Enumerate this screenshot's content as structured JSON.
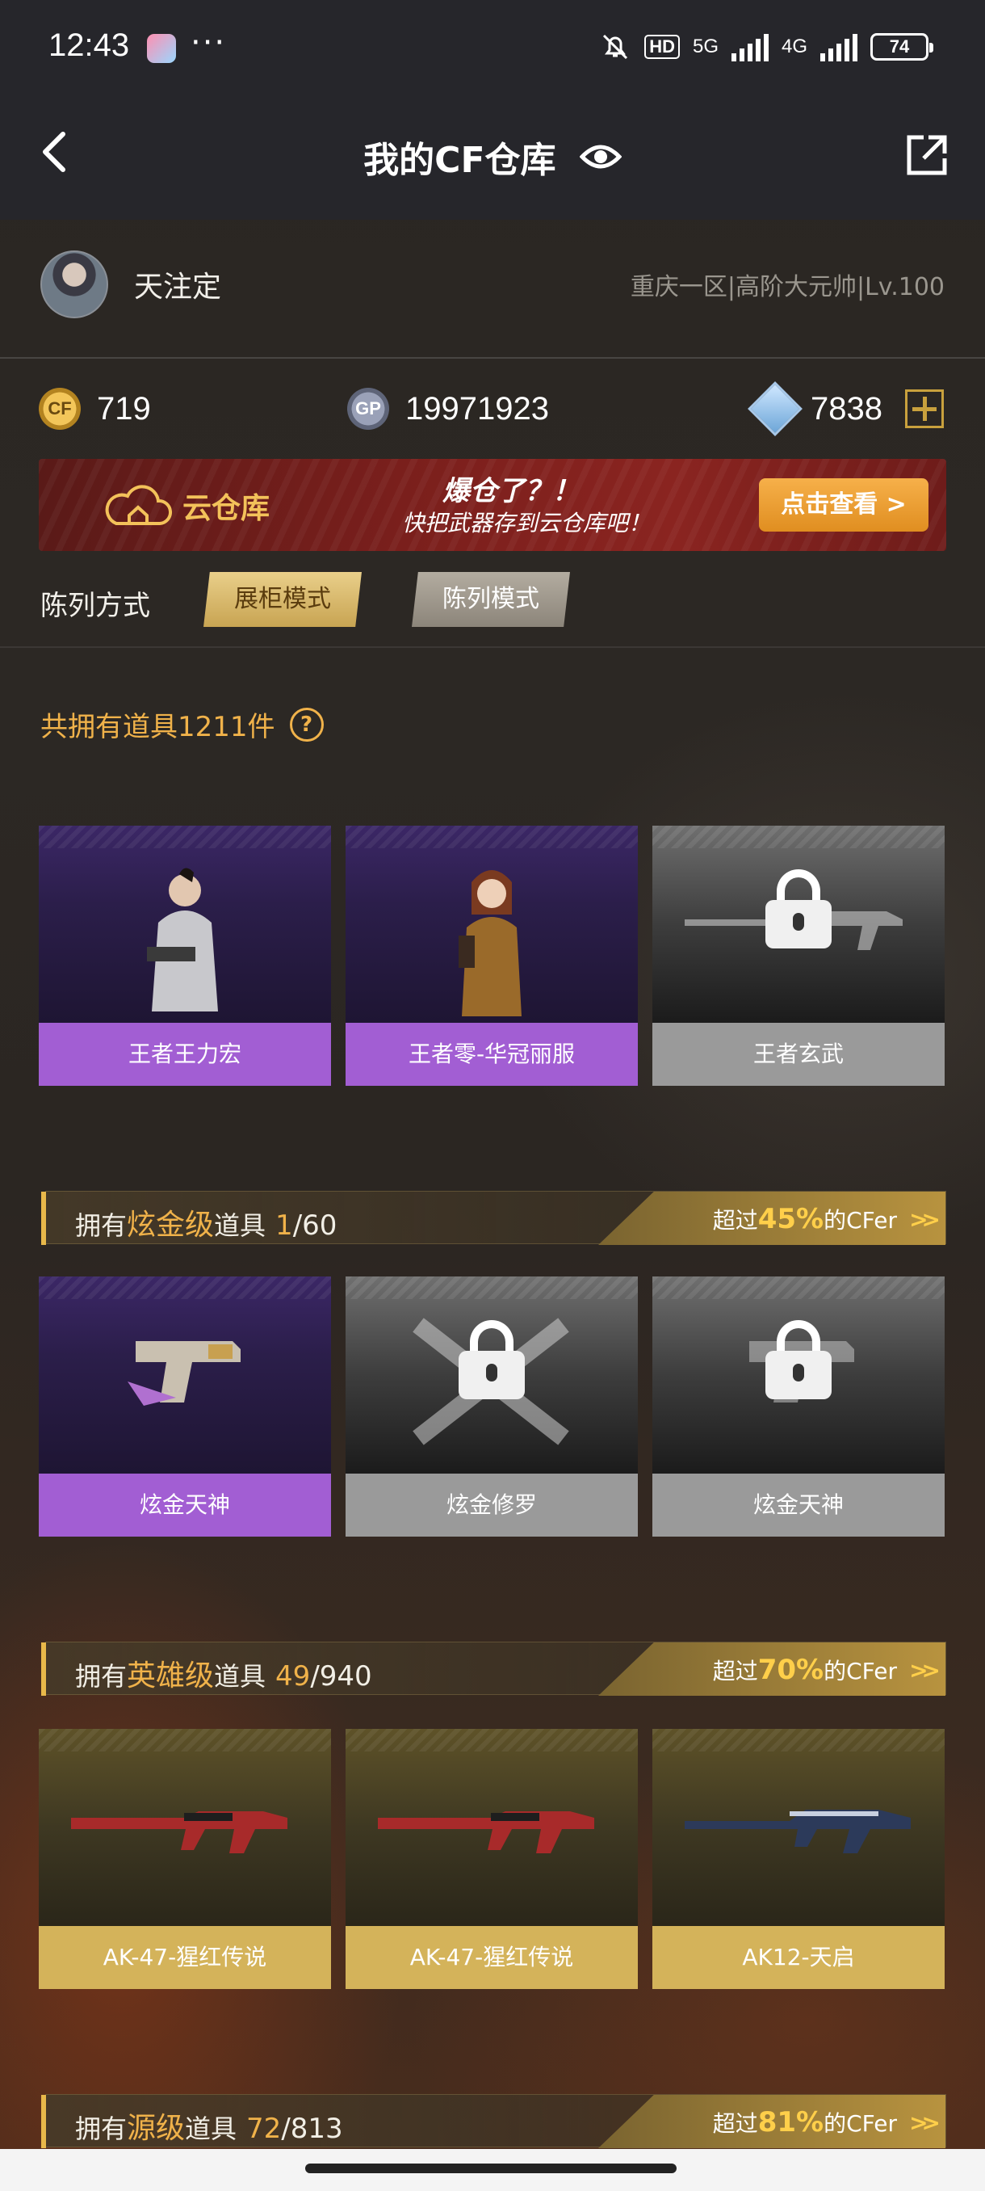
{
  "status_bar": {
    "time": "12:43",
    "more": "···",
    "net1": "5G",
    "net2": "4G",
    "hd": "HD",
    "battery": "74"
  },
  "header": {
    "title": "我的CF仓库"
  },
  "profile": {
    "name": "天注定",
    "server": "重庆一区|高阶大元帅|Lv.100"
  },
  "currency": {
    "cf": "719",
    "gp_label": "GP",
    "gp": "19971923",
    "diamond": "7838"
  },
  "banner": {
    "cloud_label": "云仓库",
    "slogan1": "爆仓了？！",
    "slogan2": "快把武器存到云仓库吧！",
    "button": "点击查看 >"
  },
  "display_mode": {
    "label": "陈列方式",
    "active": "展柜模式",
    "inactive": "陈列模式"
  },
  "total": {
    "text": "共拥有道具1211件",
    "help": "?"
  },
  "featured": [
    {
      "name": "王者王力宏",
      "rarity": "purple",
      "locked": false
    },
    {
      "name": "王者零-华冠丽服",
      "rarity": "purple",
      "locked": false
    },
    {
      "name": "王者玄武",
      "rarity": "grey",
      "locked": true
    }
  ],
  "categories": [
    {
      "prefix": "拥有",
      "level": "炫金级",
      "suffix": "道具",
      "owned": "1",
      "total": "/60",
      "pct_prefix": "超过",
      "pct": "45%",
      "pct_suffix": "的CFer",
      "items": [
        {
          "name": "炫金天神",
          "rarity": "purple",
          "locked": false
        },
        {
          "name": "炫金修罗",
          "rarity": "grey",
          "locked": true
        },
        {
          "name": "炫金天神",
          "rarity": "grey",
          "locked": true
        }
      ]
    },
    {
      "prefix": "拥有",
      "level": "英雄级",
      "suffix": "道具",
      "owned": "49",
      "total": "/940",
      "pct_prefix": "超过",
      "pct": "70%",
      "pct_suffix": "的CFer",
      "items": [
        {
          "name": "AK-47-猩红传说",
          "rarity": "gold",
          "locked": false
        },
        {
          "name": "AK-47-猩红传说",
          "rarity": "gold",
          "locked": false
        },
        {
          "name": "AK12-天启",
          "rarity": "gold",
          "locked": false
        }
      ]
    },
    {
      "prefix": "拥有",
      "level": "源级",
      "suffix": "道具",
      "owned": "72",
      "total": "/813",
      "pct_prefix": "超过",
      "pct": "81%",
      "pct_suffix": "的CFer"
    }
  ],
  "colors": {
    "accent": "#f0b24a",
    "purple": "#a25ed3",
    "gold": "#d4b35a",
    "grey": "#9a9a9a"
  }
}
